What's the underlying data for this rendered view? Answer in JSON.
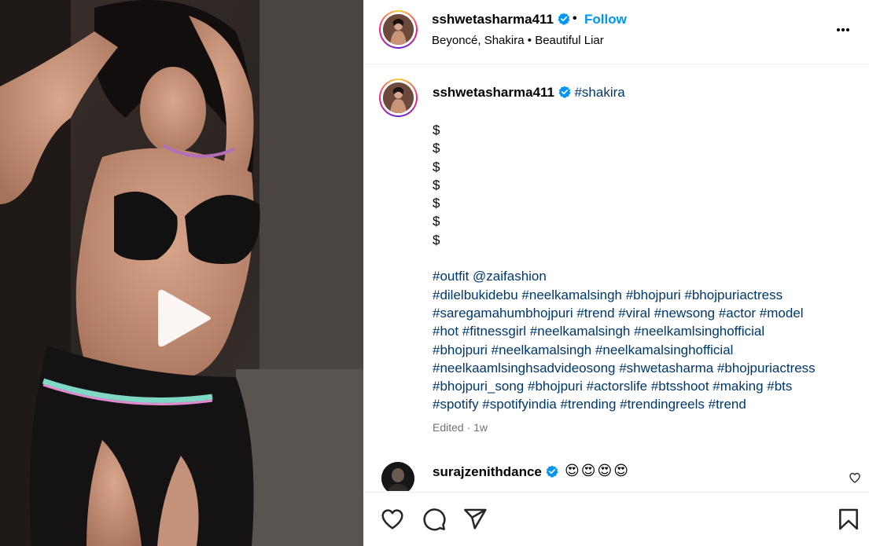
{
  "post": {
    "username": "sshwetasharma411",
    "follow_label": "Follow",
    "separator": "•",
    "audio": {
      "artists": "Beyoncé, Shakira",
      "separator": "•",
      "track": "Beautiful Liar"
    }
  },
  "caption": {
    "username": "sshwetasharma411",
    "first_tag": "#shakira",
    "dollar_lines": [
      "$",
      "$",
      "$",
      "$",
      "$",
      "$",
      "$"
    ],
    "outfit_line": "#outfit @zaifashion",
    "hashtag_lines": [
      "#dilelbukidebu #neelkamalsingh #bhojpuri #bhojpuriactress",
      "#saregamahumbhojpuri #trend #viral #newsong #actor #model",
      "#hot #fitnessgirl #neelkamalsingh #neelkamlsinghofficial",
      "#bhojpuri #neelkamalsingh #neelkamalsinghofficial",
      "#neelkaamlsinghsadvideosong #shwetasharma #bhojpuriactress",
      "#bhojpuri_song #bhojpuri #actorslife #btsshoot #making #bts",
      "#spotify #spotifyindia #trending #trendingreels #trend"
    ],
    "meta": "Edited · 1w"
  },
  "comment": {
    "username": "surajzenithdance",
    "text": "😍😍😍😍"
  },
  "icons": {
    "play": "play-icon",
    "more": "more-options-icon",
    "verified": "verified-badge-icon",
    "like": "heart-icon",
    "comment": "comment-icon",
    "share": "share-icon",
    "save": "bookmark-icon"
  },
  "colors": {
    "link": "#00376b",
    "follow": "#0095f6",
    "verified": "#0095f6",
    "muted": "#737373"
  }
}
